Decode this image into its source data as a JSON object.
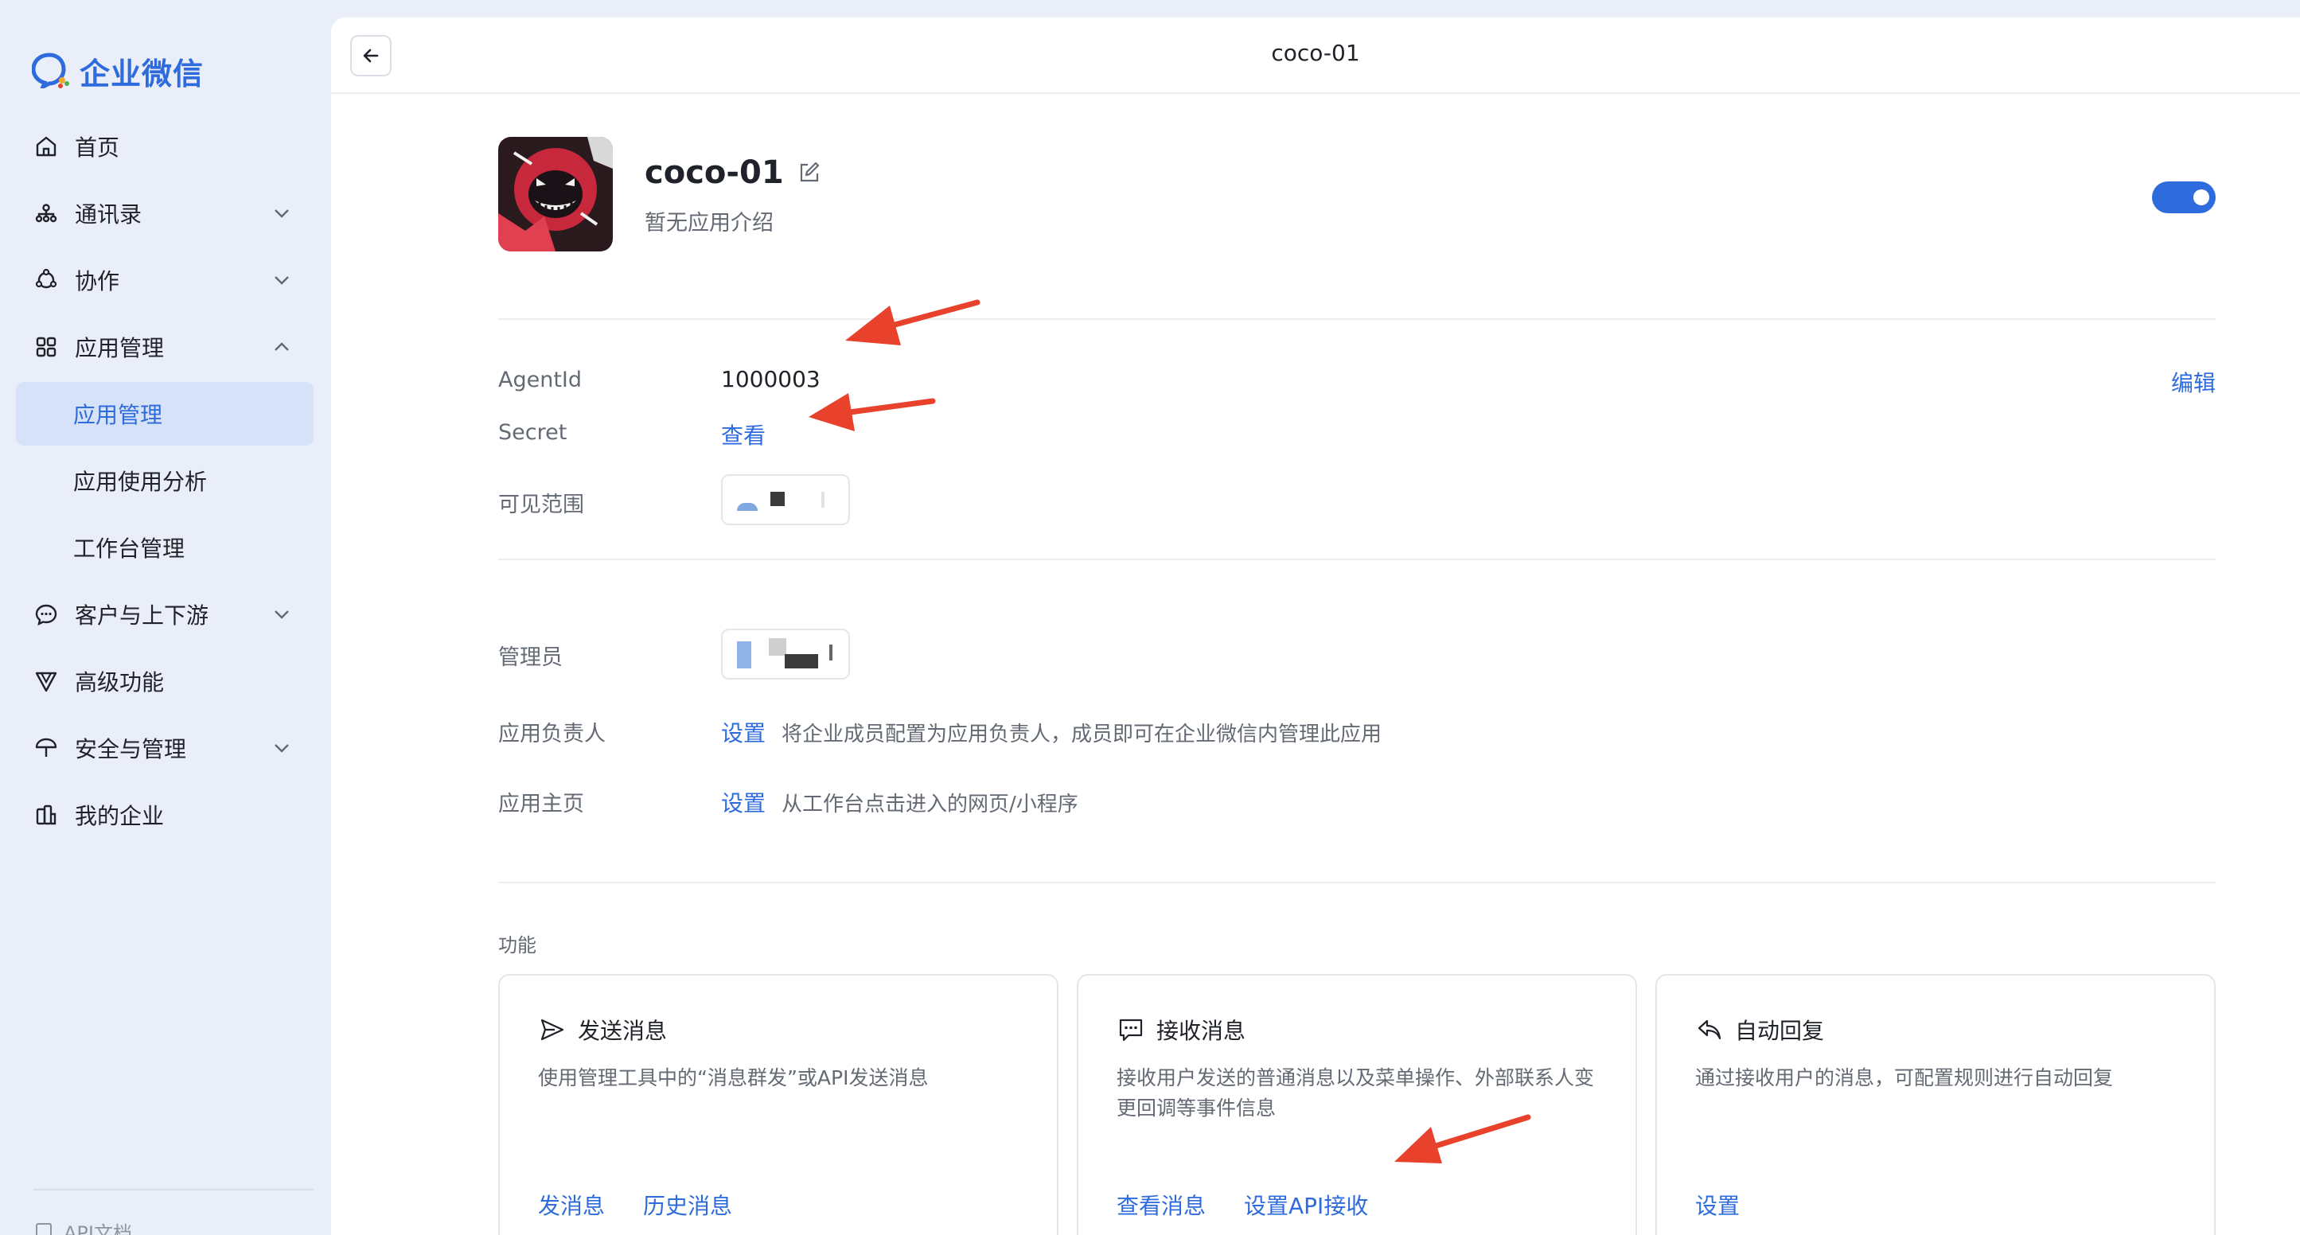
{
  "sidebar": {
    "logo_text": "企业微信",
    "items": [
      {
        "label": "首页",
        "icon": "home-icon"
      },
      {
        "label": "通讯录",
        "icon": "contacts-icon",
        "chevron": "down"
      },
      {
        "label": "协作",
        "icon": "collaboration-icon",
        "chevron": "down"
      },
      {
        "label": "应用管理",
        "icon": "apps-icon",
        "chevron": "up"
      },
      {
        "label": "应用管理",
        "sub": true,
        "active": true
      },
      {
        "label": "应用使用分析",
        "sub": true
      },
      {
        "label": "工作台管理",
        "sub": true
      },
      {
        "label": "客户与上下游",
        "icon": "chat-icon",
        "chevron": "down"
      },
      {
        "label": "高级功能",
        "icon": "advanced-icon"
      },
      {
        "label": "安全与管理",
        "icon": "umbrella-icon",
        "chevron": "down"
      },
      {
        "label": "我的企业",
        "icon": "building-icon"
      }
    ],
    "api_doc": "API文档"
  },
  "topbar": {
    "title": "coco-01"
  },
  "app": {
    "name": "coco-01",
    "description": "暂无应用介绍",
    "enabled": true
  },
  "info": {
    "agentid_label": "AgentId",
    "agentid_value": "1000003",
    "edit_label": "编辑",
    "secret_label": "Secret",
    "secret_action": "查看",
    "scope_label": "可见范围"
  },
  "settings": {
    "admin_label": "管理员",
    "owner_label": "应用负责人",
    "owner_action": "设置",
    "owner_hint": "将企业成员配置为应用负责人，成员即可在企业微信内管理此应用",
    "homepage_label": "应用主页",
    "homepage_action": "设置",
    "homepage_hint": "从工作台点击进入的网页/小程序"
  },
  "features": {
    "section_title": "功能",
    "cards": [
      {
        "title": "发送消息",
        "icon": "send-icon",
        "desc": "使用管理工具中的“消息群发”或API发送消息",
        "actions": [
          "发消息",
          "历史消息"
        ]
      },
      {
        "title": "接收消息",
        "icon": "message-icon",
        "desc": "接收用户发送的普通消息以及菜单操作、外部联系人变更回调等事件信息",
        "actions": [
          "查看消息",
          "设置API接收"
        ]
      },
      {
        "title": "自动回复",
        "icon": "reply-icon",
        "desc": "通过接收用户的消息，可配置规则进行自动回复",
        "actions": [
          "设置"
        ]
      }
    ]
  },
  "colors": {
    "accent": "#2e6bdc",
    "sidebar_bg": "#e9eef8",
    "annotation_arrow": "#e8412c"
  }
}
